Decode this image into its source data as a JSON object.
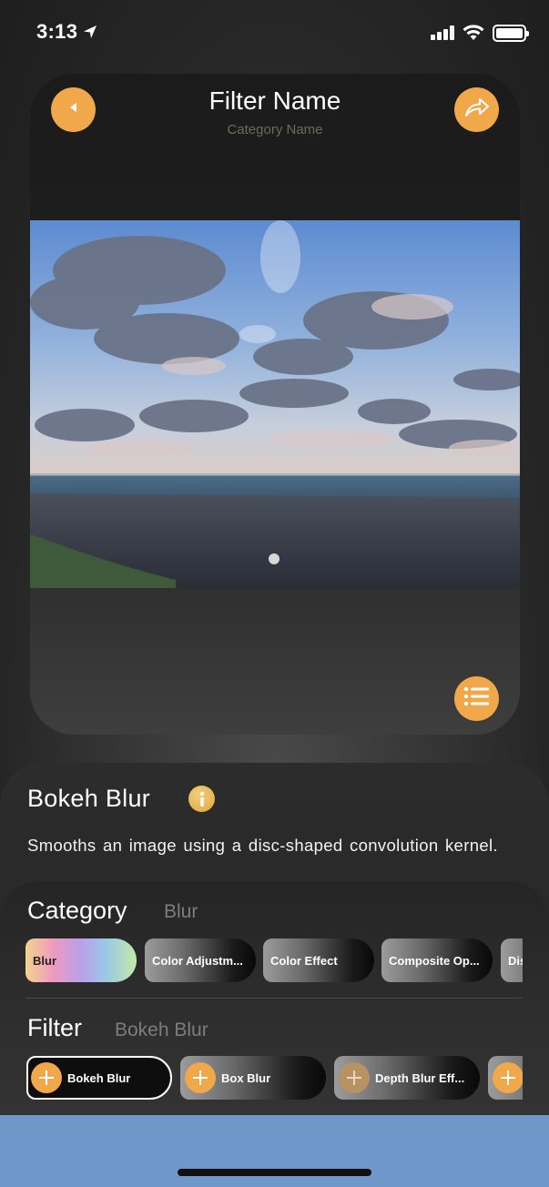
{
  "status_bar": {
    "time": "3:13",
    "icons": [
      "location-arrow-icon",
      "signal-bars-icon",
      "wifi-icon",
      "battery-icon"
    ]
  },
  "preview": {
    "title": "Filter Name",
    "subtitle": "Category Name",
    "buttons": [
      "back-button",
      "share-button",
      "list-button"
    ],
    "accent_color": "#f0a84a"
  },
  "filter_info": {
    "name": "Bokeh Blur",
    "description": "Smooths an image using a disc-shaped convolution kernel."
  },
  "category_section": {
    "label": "Category",
    "selected": "Blur",
    "chips": [
      "Blur",
      "Color Adjustm...",
      "Color Effect",
      "Composite Op...",
      "Dis"
    ]
  },
  "filter_section": {
    "label": "Filter",
    "selected": "Bokeh Blur",
    "chips": [
      "Bokeh Blur",
      "Box Blur",
      "Depth Blur Eff...",
      ""
    ]
  }
}
